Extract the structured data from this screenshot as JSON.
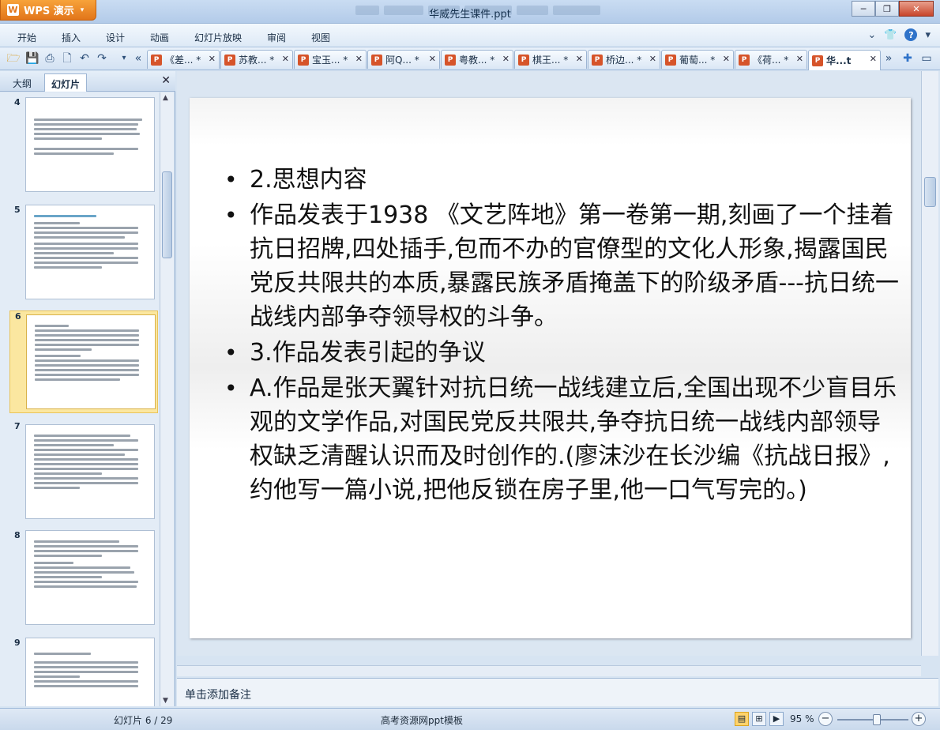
{
  "app": {
    "name": "WPS 演示"
  },
  "window": {
    "title": "华威先生课件.ppt"
  },
  "menu": [
    "开始",
    "插入",
    "设计",
    "动画",
    "幻灯片放映",
    "审阅",
    "视图"
  ],
  "tabs": [
    {
      "label": "《差...  *"
    },
    {
      "label": "苏教...  *"
    },
    {
      "label": "宝玉...  *"
    },
    {
      "label": "阿Q...  *"
    },
    {
      "label": "粤教...  *"
    },
    {
      "label": "棋王...  *"
    },
    {
      "label": "桥边...  *"
    },
    {
      "label": "葡萄...  *"
    },
    {
      "label": "《荷...  *"
    },
    {
      "label": "华...t"
    }
  ],
  "left_panel": {
    "tabs": [
      "大纲",
      "幻灯片"
    ],
    "thumb_numbers": [
      "4",
      "5",
      "6",
      "7",
      "8",
      "9"
    ]
  },
  "slide": {
    "bullets": [
      "2.思想内容",
      "作品发表于1938 《文艺阵地》第一卷第一期,刻画了一个挂着抗日招牌,四处插手,包而不办的官僚型的文化人形象,揭露国民党反共限共的本质,暴露民族矛盾掩盖下的阶级矛盾---抗日统一战线内部争夺领导权的斗争。",
      "3.作品发表引起的争议",
      "A.作品是张天翼针对抗日统一战线建立后,全国出现不少盲目乐观的文学作品,对国民党反共限共,争夺抗日统一战线内部领导权缺乏清醒认识而及时创作的.(廖沫沙在长沙编《抗战日报》,约他写一篇小说,把他反锁在房子里,他一口气写完的。)"
    ]
  },
  "notes": {
    "placeholder": "单击添加备注"
  },
  "status": {
    "slide_counter": "幻灯片 6 / 29",
    "template": "高考资源网ppt模板",
    "zoom": "95 %",
    "zoom_fraction": 0.55
  }
}
